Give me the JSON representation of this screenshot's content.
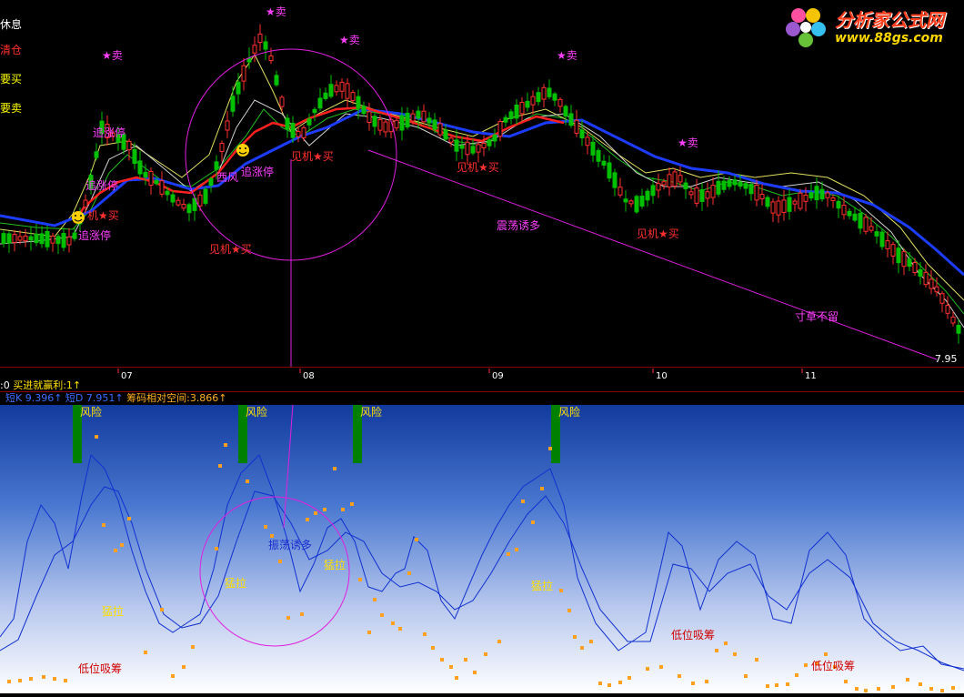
{
  "legend": [
    {
      "text": "休息",
      "color": "#ffffff"
    },
    {
      "text": "清仓",
      "color": "#ff3030"
    },
    {
      "text": "要买",
      "color": "#ffff00"
    },
    {
      "text": "要卖",
      "color": "#ffff00"
    }
  ],
  "watermark": {
    "title": "分析家公式网",
    "url": "www.88gs.com"
  },
  "annotations": {
    "sell": "★卖",
    "buy": "见机★买",
    "buy_short": "机★买",
    "chase": "追涨停",
    "west_wind": "西风",
    "shake": "震荡诱多",
    "no_grass": "寸草不留"
  },
  "price_label": "7.95",
  "date_ticks": [
    "07",
    "08",
    "09",
    "10",
    "11"
  ],
  "info1": {
    "prefix": ":0",
    "text": "买进就赢利:1↑"
  },
  "info2": {
    "a": "短K 9.396↑",
    "b": "短D 7.951↑",
    "c": "筹码相对空间:3.866↑"
  },
  "sub_labels": {
    "risk": "风险",
    "surge": "猛拉",
    "low_absorb": "低位吸筹",
    "shake_lure": "振荡诱多"
  },
  "colors": {
    "up": "#ff3030",
    "down": "#00c000",
    "ma_blue": "#1c3cff",
    "ma_red": "#ff2020",
    "magenta": "#e020e0"
  },
  "chart_data": {
    "type": "candlestick",
    "y_last": 7.95,
    "months": [
      "07",
      "08",
      "09",
      "10",
      "11"
    ]
  }
}
